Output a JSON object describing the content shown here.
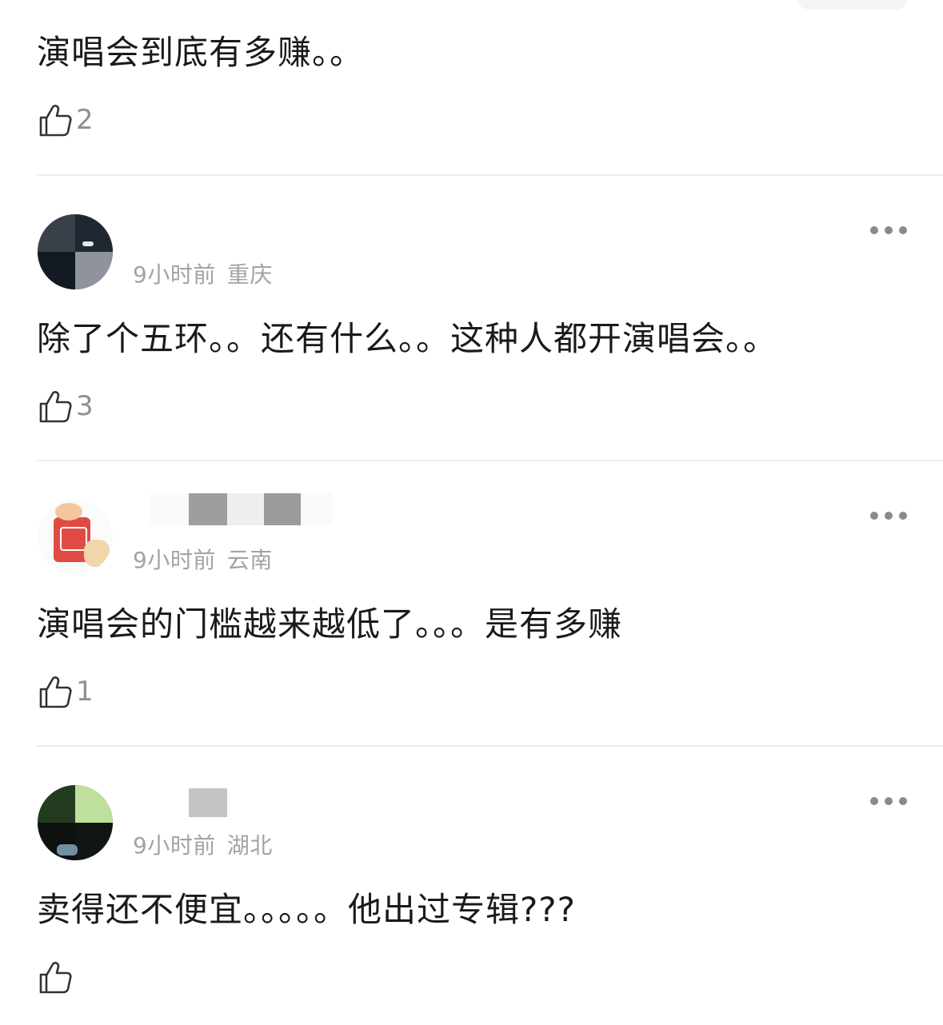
{
  "comments": [
    {
      "content": "演唱会到底有多赚。。",
      "likes": "2"
    },
    {
      "time": "9小时前",
      "location": "重庆",
      "content": "除了个五环。。还有什么。。这种人都开演唱会。。",
      "likes": "3"
    },
    {
      "time": "9小时前",
      "location": "云南",
      "content": "演唱会的门槛越来越低了。。。是有多赚",
      "likes": "1"
    },
    {
      "time": "9小时前",
      "location": "湖北",
      "content": "卖得还不便宜。。。。。他出过专辑???",
      "likes": ""
    }
  ],
  "icons": {
    "like": "thumbs-up-outline-icon",
    "more": "more-horizontal-icon"
  },
  "colors": {
    "meta_text": "#a3a3a3",
    "like_count": "#8f8f8f",
    "divider": "#ececec"
  }
}
